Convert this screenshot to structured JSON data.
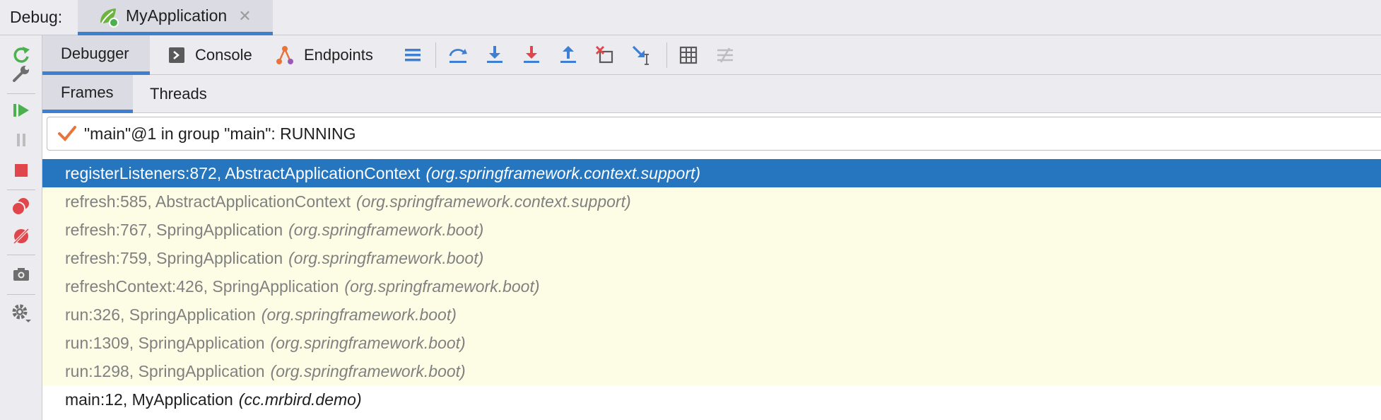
{
  "header": {
    "debug_label": "Debug:",
    "run_tab": {
      "label": "MyApplication",
      "icon": "spring-boot-app-icon",
      "close_icon": "close-icon"
    }
  },
  "left_toolbar": {
    "items": [
      {
        "name": "rerun-icon"
      },
      {
        "name": "wrench-icon"
      },
      {
        "name": "resume-icon"
      },
      {
        "name": "pause-icon"
      },
      {
        "name": "stop-icon"
      },
      {
        "name": "view-breakpoints-icon"
      },
      {
        "name": "mute-breakpoints-icon"
      },
      {
        "name": "camera-icon"
      },
      {
        "name": "settings-icon"
      }
    ]
  },
  "toolbar": {
    "tabs": [
      {
        "label": "Debugger",
        "active": true
      },
      {
        "label": "Console",
        "icon": "console-icon"
      },
      {
        "label": "Endpoints",
        "icon": "endpoints-icon"
      }
    ],
    "actions": [
      "menu-icon",
      "step-over-icon",
      "step-into-icon",
      "force-step-into-icon",
      "step-out-icon",
      "drop-frame-icon",
      "run-to-cursor-icon",
      "evaluate-expression-icon",
      "trace-current-stream-icon"
    ]
  },
  "sub_tabs": [
    {
      "label": "Frames",
      "active": true
    },
    {
      "label": "Threads"
    }
  ],
  "thread": {
    "label": "\"main\"@1 in group \"main\": RUNNING"
  },
  "frames": [
    {
      "method": "registerListeners:872, AbstractApplicationContext",
      "package": "(org.springframework.context.support)",
      "kind": "selected"
    },
    {
      "method": "refresh:585, AbstractApplicationContext",
      "package": "(org.springframework.context.support)",
      "kind": "library"
    },
    {
      "method": "refresh:767, SpringApplication",
      "package": "(org.springframework.boot)",
      "kind": "library"
    },
    {
      "method": "refresh:759, SpringApplication",
      "package": "(org.springframework.boot)",
      "kind": "library"
    },
    {
      "method": "refreshContext:426, SpringApplication",
      "package": "(org.springframework.boot)",
      "kind": "library"
    },
    {
      "method": "run:326, SpringApplication",
      "package": "(org.springframework.boot)",
      "kind": "library"
    },
    {
      "method": "run:1309, SpringApplication",
      "package": "(org.springframework.boot)",
      "kind": "library"
    },
    {
      "method": "run:1298, SpringApplication",
      "package": "(org.springframework.boot)",
      "kind": "library"
    },
    {
      "method": "main:12, MyApplication",
      "package": "(cc.mrbird.demo)",
      "kind": "user"
    }
  ],
  "colors": {
    "accent": "#3f7fd2",
    "selection": "#2675bf",
    "library_frame_bg": "#fdfde6",
    "resume_green": "#4caf50",
    "stop_red": "#e0474c"
  }
}
